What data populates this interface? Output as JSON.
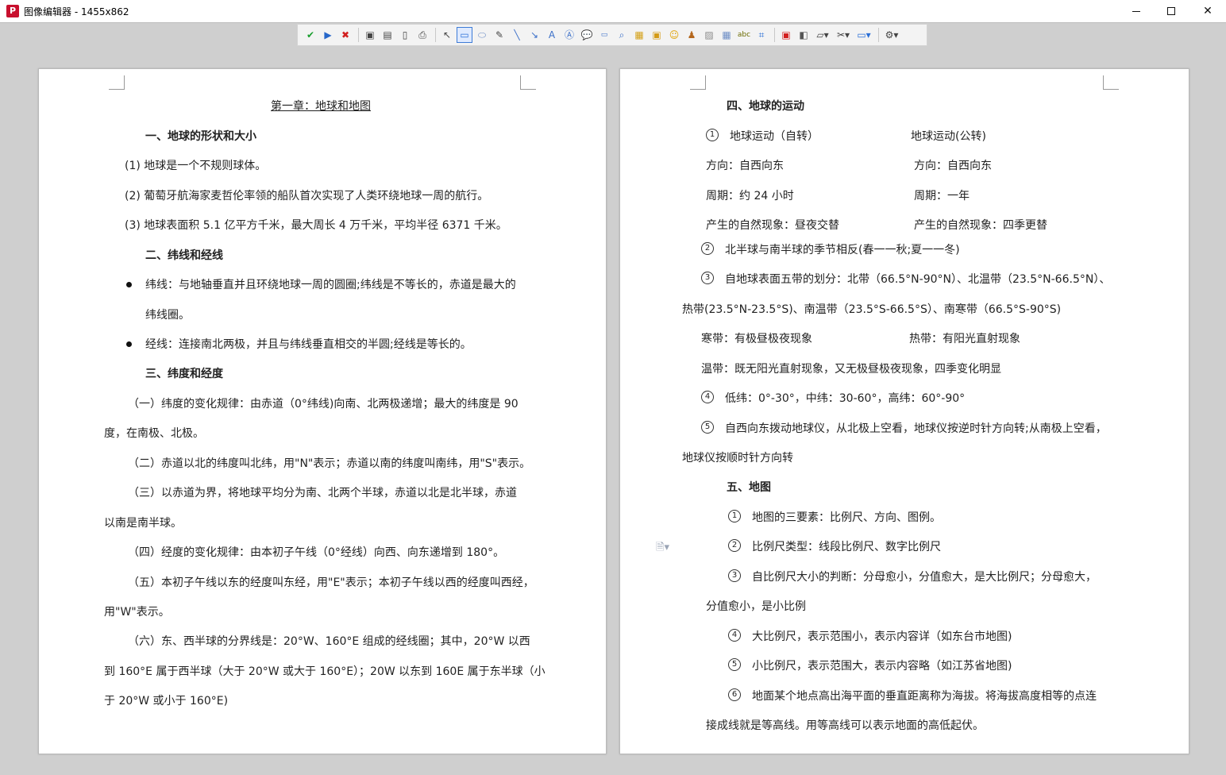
{
  "window": {
    "title": "图像编辑器 - 1455x862",
    "icon_label": "P"
  },
  "toolbar": {
    "groups": [
      [
        "check-icon",
        "play-icon",
        "close-red-icon"
      ],
      [
        "save-icon",
        "save-as-icon",
        "clipboard-icon",
        "print-icon"
      ],
      [
        "pointer-icon",
        "rectangle-select-icon",
        "ellipse-icon",
        "pen-icon",
        "line-icon",
        "arrow-icon",
        "text-icon",
        "text-box-icon",
        "callout-icon",
        "counter-icon",
        "zoom-icon",
        "highlight-icon",
        "image-icon",
        "emoji-icon",
        "stamp-icon",
        "blur-icon",
        "grid-icon",
        "spell-icon",
        "crop-icon"
      ],
      [
        "border-color-icon",
        "fill-color-icon",
        "shape-dropdown-icon",
        "tools-dropdown-icon",
        "screen-dropdown-icon"
      ],
      [
        "settings-dropdown-icon"
      ]
    ]
  },
  "left_page": {
    "chapter_title": "第一章：地球和地图",
    "s1_heading": "一、地球的形状和大小",
    "s1_items": [
      "(1)   地球是一个不规则球体。",
      "(2)   葡萄牙航海家麦哲伦率领的船队首次实现了人类环绕地球一周的航行。",
      "(3)   地球表面积 5.1 亿平方千米，最大周长 4 万千米，平均半径 6371 千米。"
    ],
    "s2_heading": "二、纬线和经线",
    "s2_b1_l1": "纬线：与地轴垂直并且环绕地球一周的圆圈;纬线是不等长的，赤道是最大的",
    "s2_b1_l2": "纬线圈。",
    "s2_b2": "经线：连接南北两极，并且与纬线垂直相交的半圆;经线是等长的。",
    "s3_heading": "三、纬度和经度",
    "p1_l1": "（一）纬度的变化规律：由赤道（0°纬线)向南、北两极递增；最大的纬度是 90",
    "p1_l2": "度，在南极、北极。",
    "p2": "（二）赤道以北的纬度叫北纬，用\"N\"表示；赤道以南的纬度叫南纬，用\"S\"表示。",
    "p3_l1": "（三）以赤道为界，将地球平均分为南、北两个半球，赤道以北是北半球，赤道",
    "p3_l2": "以南是南半球。",
    "p4": "（四）经度的变化规律：由本初子午线（0°经线）向西、向东递增到 180°。",
    "p5_l1": "（五）本初子午线以东的经度叫东经，用\"E\"表示；本初子午线以西的经度叫西经，",
    "p5_l2": "用\"W\"表示。",
    "p6_l1": "（六）东、西半球的分界线是：20°W、160°E 组成的经线圈；其中，20°W 以西",
    "p6_l2": "到 160°E 属于西半球（大于 20°W 或大于 160°E）；20W 以东到 160E 属于东半球（小",
    "p6_l3": "于 20°W 或小于 160°E)"
  },
  "right_page": {
    "s4_heading": "四、地球的运动",
    "m_c1": "1",
    "m_rot": "地球运动（自转）",
    "m_rev": "地球运动(公转)",
    "m_dir_a": "方向：自西向东",
    "m_dir_b": "方向：自西向东",
    "m_per_a": "周期：约 24 小时",
    "m_per_b": "周期：一年",
    "m_nat_a": "产生的自然现象：昼夜交替",
    "m_nat_b": "产生的自然现象：四季更替",
    "m_c2": "2",
    "m_2": "北半球与南半球的季节相反(春一一秋;夏一一冬)",
    "m_c3": "3",
    "m_3_l1": "自地球表面五带的划分：北带（66.5°N-90°N）、北温带（23.5°N-66.5°N）、",
    "m_3_l2": "热带(23.5°N-23.5°S)、南温带（23.5°S-66.5°S）、南寒带（66.5°S-90°S)",
    "m_cold": "寒带：有极昼极夜现象",
    "m_hot": "热带：有阳光直射现象",
    "m_temp": "温带：既无阳光直射现象，又无极昼极夜现象，四季变化明显",
    "m_c4": "4",
    "m_4": "低纬：0°-30°，中纬：30-60°，高纬：60°-90°",
    "m_c5": "5",
    "m_5_l1": "自西向东拨动地球仪，从北极上空看，地球仪按逆时针方向转;从南极上空看，",
    "m_5_l2": "地球仪按顺时针方向转",
    "s5_heading": "五、地图",
    "map_c1": "1",
    "map_1": "地图的三要素：比例尺、方向、图例。",
    "map_c2": "2",
    "map_2": "比例尺类型：线段比例尺、数字比例尺",
    "map_c3": "3",
    "map_3_l1": "自比例尺大小的判断：分母愈小，分值愈大，是大比例尺；分母愈大，",
    "map_3_l2": "分值愈小，是小比例",
    "map_c4": "4",
    "map_4": "大比例尺，表示范围小，表示内容详（如东台市地图)",
    "map_c5": "5",
    "map_5": "小比例尺，表示范围大，表示内容略（如江苏省地图)",
    "map_c6": "6",
    "map_6_l1": "地面某个地点高出海平面的垂直距离称为海拔。将海拔高度相等的点连",
    "map_6_l2": "接成线就是等高线。用等高线可以表示地面的高低起伏。"
  }
}
